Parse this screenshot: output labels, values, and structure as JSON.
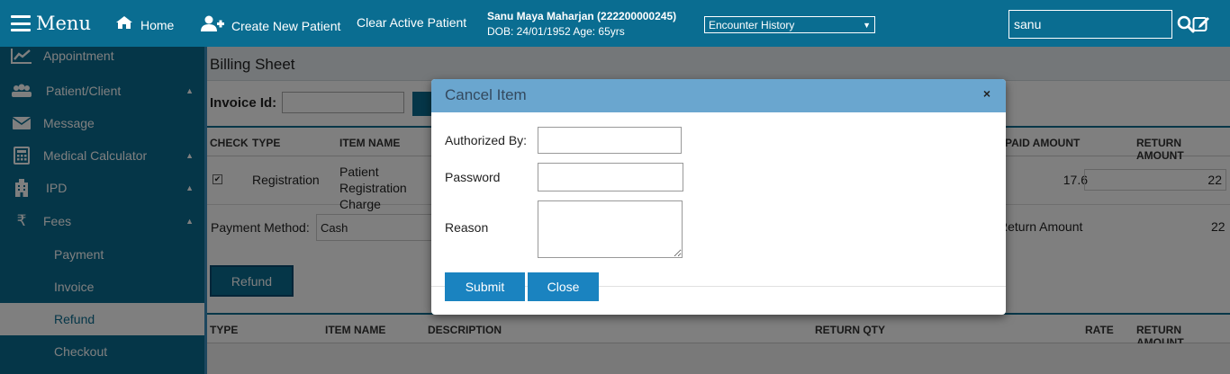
{
  "topbar": {
    "menu_label": "Menu",
    "home_label": "Home",
    "create_patient_label": "Create New Patient",
    "clear_patient_label": "Clear Active Patient",
    "patient_name": "Sanu Maya Maharjan (222200000245)",
    "patient_dob": "DOB: 24/01/1952 Age: 65yrs",
    "encounter_selected": "Encounter History",
    "search_value": "sanu"
  },
  "sidebar": {
    "items": [
      {
        "label": "Appointment",
        "icon": "chart-line-icon"
      },
      {
        "label": "Patient/Client",
        "icon": "users-icon"
      },
      {
        "label": "Message",
        "icon": "envelope-icon"
      },
      {
        "label": "Medical Calculator",
        "icon": "calculator-icon"
      },
      {
        "label": "IPD",
        "icon": "hospital-icon"
      },
      {
        "label": "Fees",
        "icon": "rupee-icon"
      }
    ],
    "subitems": [
      {
        "label": "Payment"
      },
      {
        "label": "Invoice"
      },
      {
        "label": "Refund",
        "active": true
      },
      {
        "label": "Checkout"
      }
    ]
  },
  "main": {
    "title": "Billing Sheet",
    "invoice_label": "Invoice Id:",
    "table1": {
      "headers": {
        "check": "CHECK",
        "type": "TYPE",
        "item_name": "ITEM NAME",
        "paid_amount": "PAID AMOUNT",
        "return_amount": "RETURN AMOUNT"
      },
      "row": {
        "checked": "✔",
        "type": "Registration",
        "item_name": "Patient Registration Charge",
        "paid": "17.6",
        "return": "22"
      }
    },
    "payment_method_label": "Payment Method:",
    "payment_method_value": "Cash",
    "return_amount_label": "Return Amount",
    "return_amount_value": "22",
    "refund_button": "Refund",
    "table2": {
      "headers": {
        "type": "TYPE",
        "item_name": "ITEM NAME",
        "description": "DESCRIPTION",
        "return_qty": "RETURN QTY",
        "rate": "RATE",
        "return_amount": "RETURN AMOUNT"
      }
    }
  },
  "modal": {
    "title": "Cancel Item",
    "close_glyph": "×",
    "authorized_by_label": "Authorized By:",
    "password_label": "Password",
    "reason_label": "Reason",
    "submit_label": "Submit",
    "close_label": "Close"
  },
  "colors": {
    "brand": "#0a6d91",
    "modal_header": "#6aa6cf",
    "button": "#1a83c0"
  }
}
